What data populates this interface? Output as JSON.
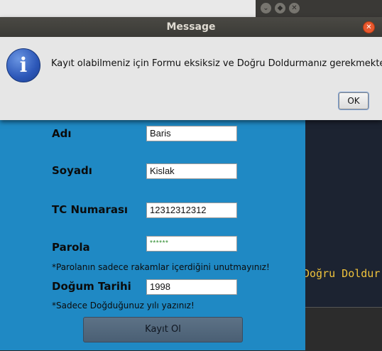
{
  "dialog": {
    "title": "Message",
    "message": "Kayıt olabilmeniz için Formu eksiksiz ve Doğru Doldurmanız gerekmektedir",
    "ok_label": "OK",
    "close_glyph": "✕",
    "icon": "info-icon",
    "icon_glyph": "i"
  },
  "window_buttons": {
    "minimize": "⌄",
    "maximize": "◆",
    "close": "✕"
  },
  "form": {
    "name_label": "Adı",
    "name_value": "Baris",
    "surname_label": "Soyadı",
    "surname_value": "Kislak",
    "tc_label": "TC Numarası",
    "tc_value": "12312312312",
    "password_label": "Parola",
    "password_value": "******",
    "password_note": "*Parolanın sadece rakamlar içerdiğini unutmayınız!",
    "birth_label": "Doğum Tarihi",
    "birth_value": "1998",
    "birth_note": "*Sadece Doğduğunuz yılı yazınız!",
    "submit_label": "Kayıt Ol"
  },
  "terminal": {
    "line": "Doğru Doldur"
  },
  "colors": {
    "form_background": "#1f89c4",
    "dialog_background": "#e6e6e6",
    "terminal_text": "#f0c33c",
    "password_dots": "#2a8a2a"
  }
}
